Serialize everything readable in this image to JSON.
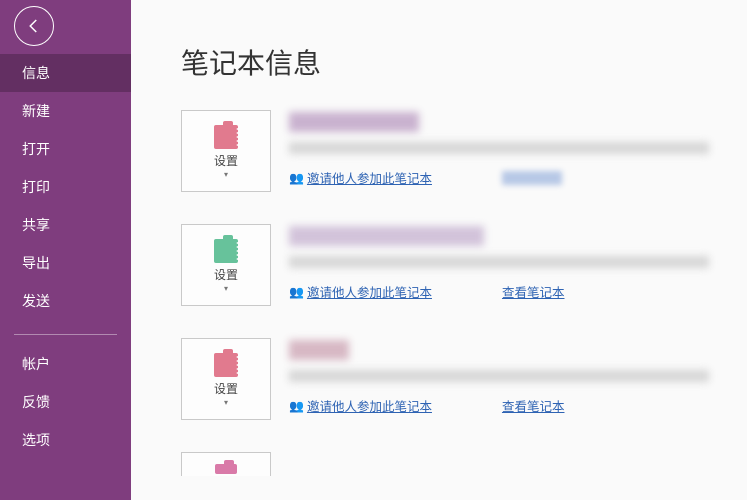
{
  "sidebar": {
    "items": [
      {
        "label": "信息",
        "active": true
      },
      {
        "label": "新建"
      },
      {
        "label": "打开"
      },
      {
        "label": "打印"
      },
      {
        "label": "共享"
      },
      {
        "label": "导出"
      },
      {
        "label": "发送"
      }
    ],
    "bottom_items": [
      {
        "label": "帐户"
      },
      {
        "label": "反馈"
      },
      {
        "label": "选项"
      }
    ]
  },
  "page": {
    "title": "笔记本信息",
    "settings_label": "设置",
    "invite_label": "邀请他人参加此笔记本",
    "view_label": "查看笔记本"
  },
  "notebooks": [
    {
      "icon_color": "#e17a8e",
      "has_view_link": false
    },
    {
      "icon_color": "#67c29b",
      "has_view_link": true
    },
    {
      "icon_color": "#e17a8e",
      "has_view_link": true
    }
  ]
}
